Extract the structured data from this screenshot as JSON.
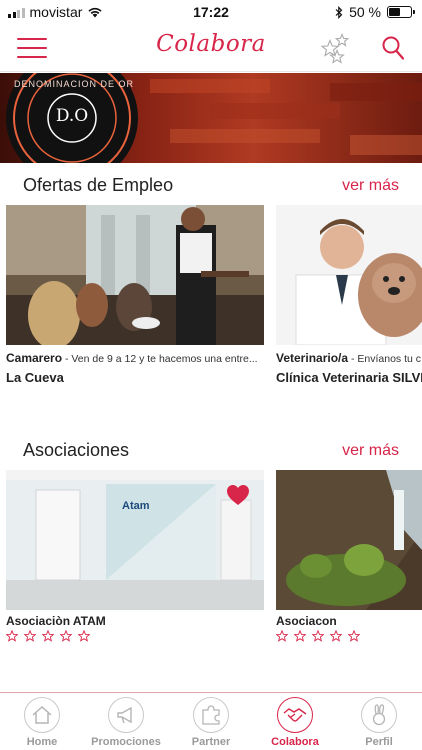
{
  "status_bar": {
    "carrier": "movistar",
    "time": "17:22",
    "battery": "50 %",
    "battery_level": 0.5
  },
  "header": {
    "title": "Colabora"
  },
  "colors": {
    "accent": "#d8254a"
  },
  "hero": {
    "logo_text": "D.O",
    "ring_text": "DENOMINACION DE ORIGEN"
  },
  "jobs": {
    "title": "Ofertas de Empleo",
    "more": "ver más",
    "items": [
      {
        "role": "Camarero",
        "separator": " - ",
        "description": "Ven de 9 a 12 y te hacemos una entre...",
        "company": "La Cueva"
      },
      {
        "role": "Veterinario/a",
        "separator": " - ",
        "description": "Envíanos tu c",
        "company": "Clínica Veterinaria SILVIO"
      }
    ]
  },
  "associations": {
    "title": "Asociaciones",
    "more": "ver más",
    "items": [
      {
        "name": "Asociaciòn ATAM",
        "sign": "Atam",
        "rating": 0,
        "favorite": true
      },
      {
        "name": "Asociacon",
        "rating": 0,
        "favorite": false
      }
    ]
  },
  "tabs": [
    {
      "label": "Home",
      "icon": "home-icon"
    },
    {
      "label": "Promociones",
      "icon": "megaphone-icon"
    },
    {
      "label": "Partner",
      "icon": "puzzle-icon"
    },
    {
      "label": "Colabora",
      "icon": "handshake-icon",
      "active": true
    },
    {
      "label": "Perfil",
      "icon": "bunny-icon"
    }
  ]
}
